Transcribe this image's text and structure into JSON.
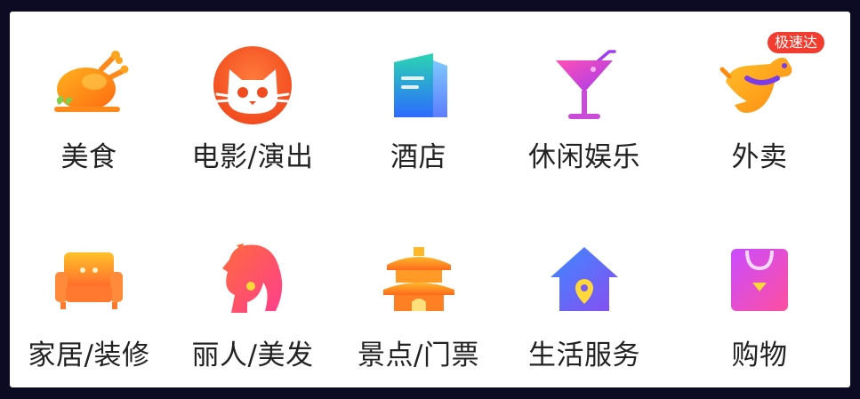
{
  "colors": {
    "background": "#0d0b24",
    "panel": "#ffffff",
    "label": "#222222",
    "badge": "#f13c2f"
  },
  "categories": [
    {
      "label": "美食",
      "icon": "roast-chicken-icon"
    },
    {
      "label": "电影/演出",
      "icon": "cat-face-icon"
    },
    {
      "label": "酒店",
      "icon": "hotel-building-icon"
    },
    {
      "label": "休闲娱乐",
      "icon": "cocktail-glass-icon"
    },
    {
      "label": "外卖",
      "icon": "kangaroo-icon",
      "badge": "极速达"
    },
    {
      "label": "家居/装修",
      "icon": "sofa-icon"
    },
    {
      "label": "丽人/美发",
      "icon": "woman-profile-icon"
    },
    {
      "label": "景点/门票",
      "icon": "pagoda-icon"
    },
    {
      "label": "生活服务",
      "icon": "house-location-icon"
    },
    {
      "label": "购物",
      "icon": "shopping-bag-icon"
    }
  ]
}
